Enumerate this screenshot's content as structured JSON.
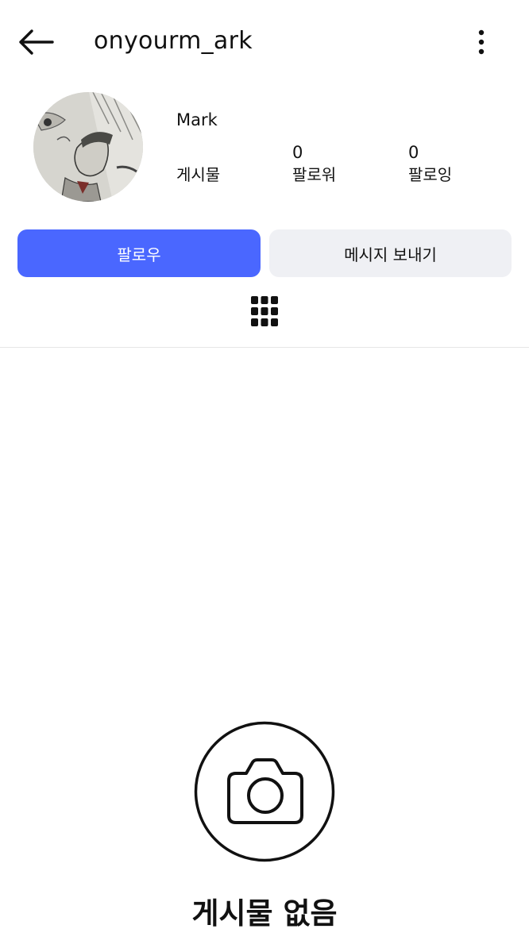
{
  "header": {
    "back_icon": "arrow-left-icon",
    "username": "onyourm_ark",
    "more_icon": "more-vertical-icon"
  },
  "profile": {
    "avatar_icon": "profile-photo",
    "display_name": "Mark",
    "stats": {
      "posts_label": "게시물",
      "followers_count": "0",
      "followers_label": "팔로워",
      "following_count": "0",
      "following_label": "팔로잉"
    }
  },
  "actions": {
    "follow_label": "팔로우",
    "message_label": "메시지 보내기"
  },
  "tabs": {
    "grid_icon": "grid-icon"
  },
  "empty_state": {
    "icon": "camera-icon",
    "text": "게시물 없음"
  },
  "colors": {
    "accent": "#4a67ff",
    "secondary_button": "#eff0f4",
    "text": "#111111"
  }
}
